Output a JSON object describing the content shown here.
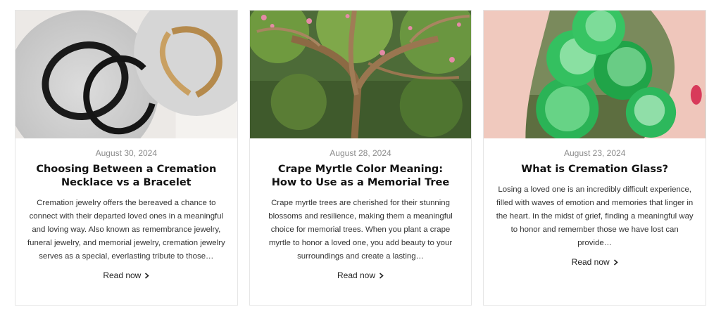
{
  "posts": [
    {
      "image_alt": "bracelet-photo",
      "date": "August 30, 2024",
      "title": "Choosing Between a Cremation Necklace vs a Bracelet",
      "excerpt": "Cremation jewelry offers the bereaved a chance to connect with their departed loved ones in a meaningful and loving way. Also known as remembrance jewelry, funeral jewelry, and memorial jewelry, cremation jewelry serves as a special, everlasting tribute to those…",
      "read_more": "Read now"
    },
    {
      "image_alt": "crape-myrtle-photo",
      "date": "August 28, 2024",
      "title": "Crape Myrtle Color Meaning: How to Use as a Memorial Tree",
      "excerpt": "Crape myrtle trees are cherished for their stunning blossoms and resilience, making them a meaningful choice for memorial trees. When you plant a crape myrtle to honor a loved one, you add beauty to your surroundings and create a lasting…",
      "read_more": "Read now"
    },
    {
      "image_alt": "cremation-glass-photo",
      "date": "August 23, 2024",
      "title": "What is Cremation Glass?",
      "excerpt": "Losing a loved one is an incredibly difficult experience, filled with waves of emotion and memories that linger in the heart. In the midst of grief, finding a meaningful way to honor and remember those we have lost can provide…",
      "read_more": "Read now"
    }
  ],
  "icons": {
    "read_more": "chevron-right-icon"
  }
}
